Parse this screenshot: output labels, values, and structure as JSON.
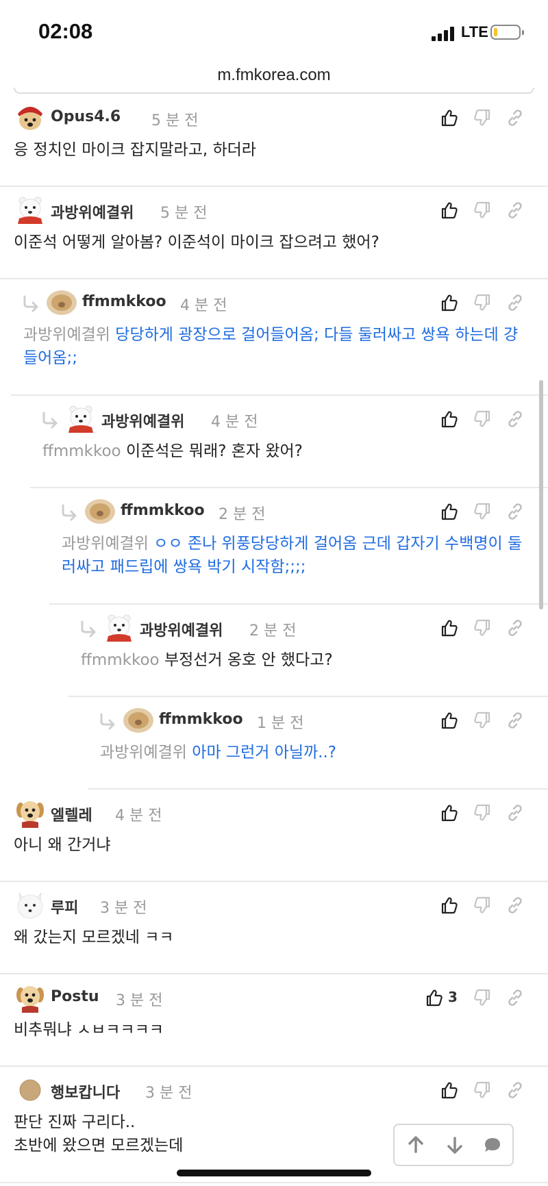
{
  "status": {
    "time": "02:08",
    "network": "LTE"
  },
  "browser": {
    "url": "m.fmkorea.com"
  },
  "colors": {
    "mention_text": "#1f6ce0",
    "mention_user": "#9a9a9a"
  },
  "comments": [
    {
      "user": "Opus4.6",
      "time": "5 분 전",
      "avatar": "dog-red-hat",
      "mention": "",
      "text": "응 정치인 마이크 잡지말라고, 하더라",
      "highlight": false,
      "likes": ""
    },
    {
      "user": "과방위예결위",
      "time": "5 분 전",
      "avatar": "polar-bear",
      "mention": "",
      "text": "이준석 어떻게 알아봄? 이준석이 마이크 잡으려고 했어?",
      "highlight": false,
      "likes": ""
    },
    {
      "user": "ffmmkkoo",
      "time": "4 분 전",
      "avatar": "blurred-dog",
      "mention": "과방위예결위",
      "text": "당당하게 광장으로 걸어들어옴; 다들 둘러싸고 쌍욕 하는데 걍 들어옴;;",
      "highlight": true,
      "likes": ""
    },
    {
      "user": "과방위예결위",
      "time": "4 분 전",
      "avatar": "polar-bear",
      "mention": "ffmmkkoo",
      "text": "이준석은 뭐래? 혼자 왔어?",
      "highlight": false,
      "likes": ""
    },
    {
      "user": "ffmmkkoo",
      "time": "2 분 전",
      "avatar": "blurred-dog",
      "mention": "과방위예결위",
      "text": "ㅇㅇ 존나 위풍당당하게 걸어옴 근데 갑자기 수백명이 둘러싸고 패드립에 쌍욕 박기 시작함;;;;",
      "highlight": true,
      "likes": ""
    },
    {
      "user": "과방위예결위",
      "time": "2 분 전",
      "avatar": "polar-bear",
      "mention": "ffmmkkoo",
      "text": "부정선거 옹호 안 했다고?",
      "highlight": false,
      "likes": ""
    },
    {
      "user": "ffmmkkoo",
      "time": "1 분 전",
      "avatar": "blurred-dog",
      "mention": "과방위예결위",
      "text": "아마 그런거 아닐까..?",
      "highlight": true,
      "likes": ""
    },
    {
      "user": "엘렐레",
      "time": "4 분 전",
      "avatar": "puppy",
      "mention": "",
      "text": "아니 왜 간거냐",
      "highlight": false,
      "likes": ""
    },
    {
      "user": "루피",
      "time": "3 분 전",
      "avatar": "white-fox",
      "mention": "",
      "text": "왜 갔는지 모르겠네 ㅋㅋ",
      "highlight": false,
      "likes": ""
    },
    {
      "user": "Postu",
      "time": "3 분 전",
      "avatar": "puppy",
      "mention": "",
      "text": "비추뭐냐 ㅅㅂㅋㅋㅋㅋ",
      "highlight": false,
      "likes": "3"
    },
    {
      "user": "행보캅니다",
      "time": "3 분 전",
      "avatar": "tan-circle",
      "mention": "",
      "text": "판단 진짜 구리다..\n초반에 왔으면 모르겠는데",
      "highlight": false,
      "likes": ""
    }
  ],
  "icons": {
    "like": "thumbs-up-icon",
    "dislike": "thumbs-down-icon",
    "link": "link-icon",
    "reply": "reply-arrow-icon"
  },
  "floating_nav": {
    "up": "arrow-up-icon",
    "down": "arrow-down-icon",
    "comment": "comment-bubble-icon"
  }
}
